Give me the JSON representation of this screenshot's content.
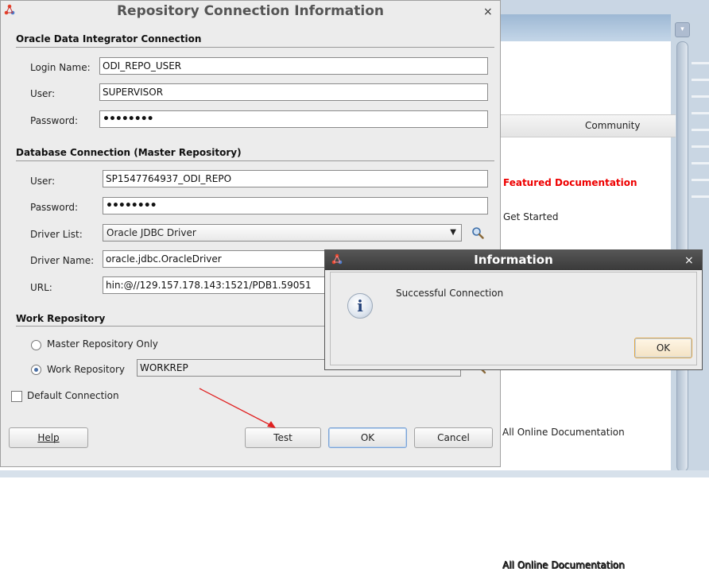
{
  "main_dialog": {
    "title": "Repository Connection Information",
    "close_glyph": "×",
    "odi_section": {
      "heading": "Oracle Data Integrator Connection",
      "login_name_label": "Login Name:",
      "login_name_value": "ODI_REPO_USER",
      "user_label": "User:",
      "user_value": "SUPERVISOR",
      "password_label": "Password:",
      "password_value": "••••••••"
    },
    "db_section": {
      "heading": "Database Connection (Master Repository)",
      "user_label": "User:",
      "user_value": "SP1547764937_ODI_REPO",
      "password_label": "Password:",
      "password_value": "••••••••",
      "driver_list_label": "Driver List:",
      "driver_list_value": "Oracle JDBC Driver",
      "driver_name_label": "Driver Name:",
      "driver_name_value": "oracle.jdbc.OracleDriver",
      "url_label": "URL:",
      "url_value": "hin:@//129.157.178.143:1521/PDB1.59051"
    },
    "work_section": {
      "heading": "Work Repository",
      "option_master": "Master Repository Only",
      "option_work": "Work Repository",
      "work_value": "WORKREP",
      "selected": "Work Repository"
    },
    "default_connection_label": "Default Connection",
    "buttons": {
      "help": "Help",
      "test": "Test",
      "ok": "OK",
      "cancel": "Cancel"
    }
  },
  "info_dialog": {
    "title": "Information",
    "close_glyph": "×",
    "icon_glyph": "i",
    "message": "Successful Connection",
    "ok": "OK"
  },
  "background": {
    "column_header": "Community",
    "featured": "Featured Documentation",
    "get_started": "Get Started",
    "all_online": "All Online Documentation"
  },
  "annotation_color": "#e02020"
}
